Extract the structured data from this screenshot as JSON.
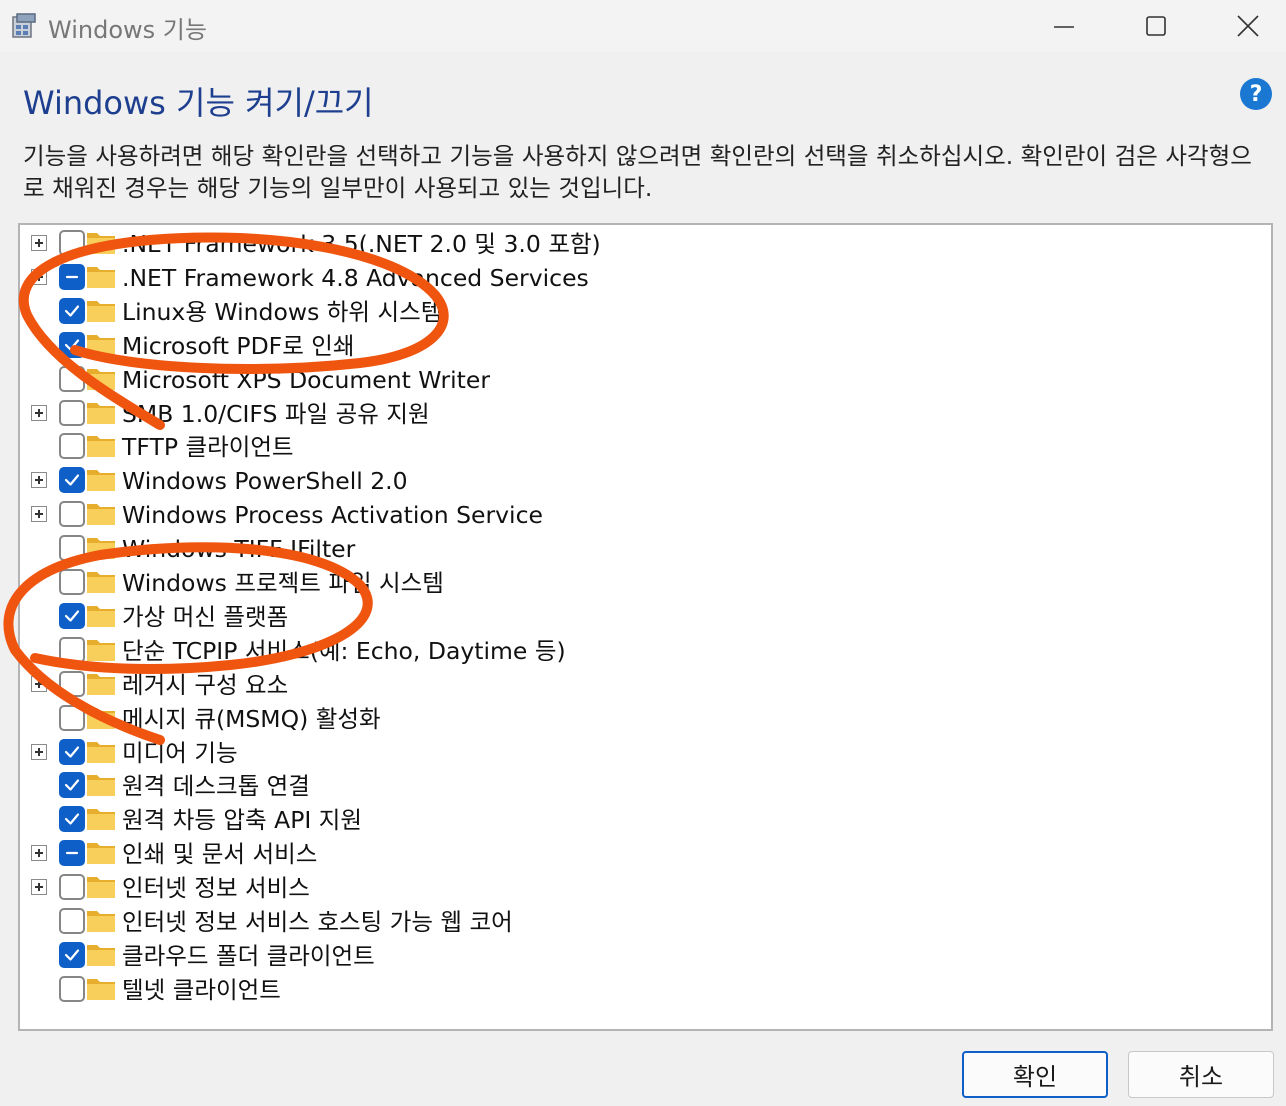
{
  "window": {
    "title": "Windows 기능",
    "icon": "windows-features-app-icon",
    "controls": [
      "minimize-icon",
      "maximize-icon",
      "close-icon"
    ]
  },
  "heading": "Windows 기능 켜기/끄기",
  "help": {
    "glyph": "?",
    "icon": "help-icon"
  },
  "description": "기능을 사용하려면 해당 확인란을 선택하고 기능을 사용하지 않으려면 확인란의 선택을 취소하십시오. 확인란이 검은 사각형으로 채워진 경우는 해당 기능의 일부만이 사용되고 있는 것입니다.",
  "features": [
    {
      "label": ".NET Framework 3.5(.NET 2.0 및 3.0 포함)",
      "state": "unchecked",
      "expandable": true
    },
    {
      "label": ".NET Framework 4.8 Advanced Services",
      "state": "partial",
      "expandable": true
    },
    {
      "label": "Linux용 Windows 하위 시스템",
      "state": "checked",
      "expandable": false
    },
    {
      "label": "Microsoft PDF로 인쇄",
      "state": "checked",
      "expandable": false
    },
    {
      "label": "Microsoft XPS Document Writer",
      "state": "unchecked",
      "expandable": false
    },
    {
      "label": "SMB 1.0/CIFS 파일 공유 지원",
      "state": "unchecked",
      "expandable": true
    },
    {
      "label": "TFTP 클라이언트",
      "state": "unchecked",
      "expandable": false
    },
    {
      "label": "Windows PowerShell 2.0",
      "state": "checked",
      "expandable": true
    },
    {
      "label": "Windows Process Activation Service",
      "state": "unchecked",
      "expandable": true
    },
    {
      "label": "Windows TIFF IFilter",
      "state": "unchecked",
      "expandable": false
    },
    {
      "label": "Windows 프로젝트 파일 시스템",
      "state": "unchecked",
      "expandable": false
    },
    {
      "label": "가상 머신 플랫폼",
      "state": "checked",
      "expandable": false
    },
    {
      "label": "단순 TCPIP 서비스(예: Echo, Daytime 등)",
      "state": "unchecked",
      "expandable": false
    },
    {
      "label": "레거시 구성 요소",
      "state": "unchecked",
      "expandable": true
    },
    {
      "label": "메시지 큐(MSMQ) 활성화",
      "state": "unchecked",
      "expandable": false
    },
    {
      "label": "미디어 기능",
      "state": "checked",
      "expandable": true
    },
    {
      "label": "원격 데스크톱 연결",
      "state": "checked",
      "expandable": false
    },
    {
      "label": "원격 차등 압축 API 지원",
      "state": "checked",
      "expandable": false
    },
    {
      "label": "인쇄 및 문서 서비스",
      "state": "partial",
      "expandable": true
    },
    {
      "label": "인터넷 정보 서비스",
      "state": "unchecked",
      "expandable": true
    },
    {
      "label": "인터넷 정보 서비스 호스팅 가능 웹 코어",
      "state": "unchecked",
      "expandable": false
    },
    {
      "label": "클라우드 폴더 클라이언트",
      "state": "checked",
      "expandable": false
    },
    {
      "label": "텔넷 클라이언트",
      "state": "unchecked",
      "expandable": false
    }
  ],
  "buttons": {
    "ok": "확인",
    "cancel": "취소"
  },
  "colors": {
    "heading": "#1e3f8f",
    "checkbox_checked": "#0f5fc8",
    "folder": "#f2c44d",
    "annotation": "#f0550f"
  },
  "annotations": [
    "circle-annotation-top",
    "circle-annotation-bottom"
  ]
}
